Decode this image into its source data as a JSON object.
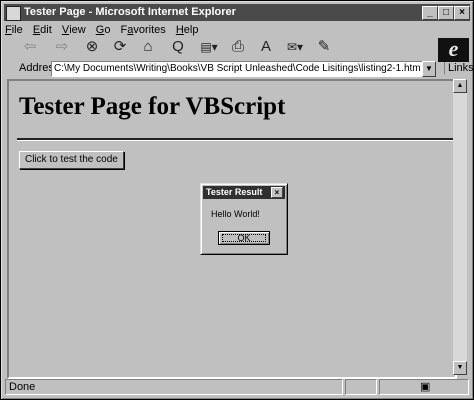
{
  "window": {
    "title": "Tester Page - Microsoft Internet Explorer"
  },
  "title_buttons": {
    "minimize": "_",
    "maximize": "□",
    "close": "×"
  },
  "menu": [
    {
      "letter": "F",
      "rest": "ile"
    },
    {
      "letter": "E",
      "rest": "dit"
    },
    {
      "letter": "V",
      "rest": "iew"
    },
    {
      "letter": "G",
      "rest": "o"
    },
    {
      "letter": "F",
      "rest": "avorites",
      "prefix": "F",
      "mid": "a"
    },
    {
      "letter": "H",
      "rest": "elp"
    }
  ],
  "toolbar_icons": [
    "back-icon",
    "forward-icon",
    "stop-icon",
    "refresh-icon",
    "home-icon",
    "search-icon",
    "favorites-icon",
    "print-icon",
    "font-icon",
    "mail-icon",
    "edit-icon"
  ],
  "toolbar_glyphs": [
    "⇦",
    "⇨",
    "⊗",
    "⟳",
    "⌂",
    "Q",
    "▤▾",
    "⎙",
    "A",
    "✉▾",
    "✎"
  ],
  "logo": "e",
  "address": {
    "label": "Address",
    "value": "C:\\My Documents\\Writing\\Books\\VB Script Unleashed\\Code Lisitings\\listing2-1.htm",
    "dropdown": "▼",
    "links": "Links"
  },
  "page": {
    "heading": "Tester Page for VBScript",
    "test_button": "Click to test the code"
  },
  "dialog": {
    "title": "Tester Result",
    "close": "×",
    "message": "Hello World!",
    "ok": "OK"
  },
  "scrollbar": {
    "up": "▲",
    "down": "▼"
  },
  "status": {
    "text": "Done",
    "zone_icon": "▣"
  },
  "colors": {
    "titlebar": "#4a4a4a",
    "face": "#c0c0c0",
    "dialog_title": "#303030"
  }
}
